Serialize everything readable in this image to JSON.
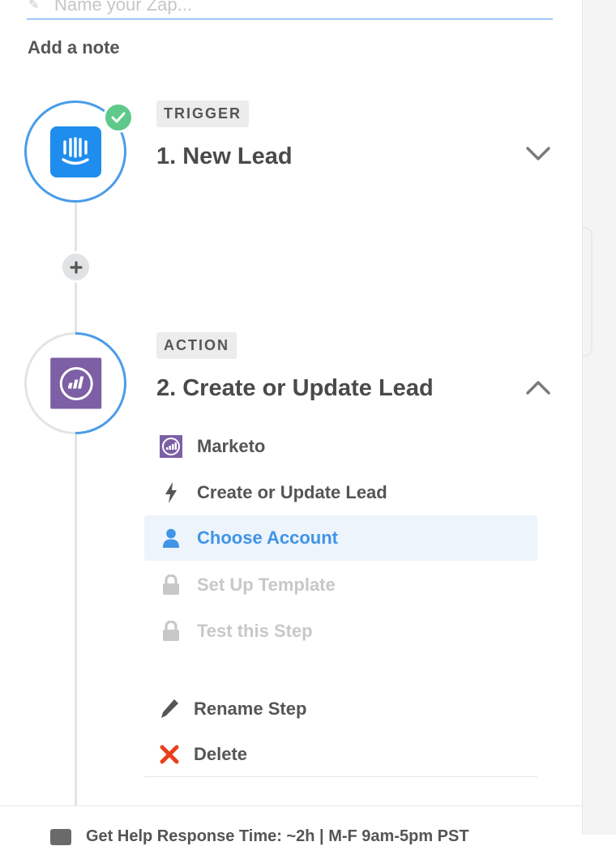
{
  "zap_name": {
    "placeholder": "Name your Zap..."
  },
  "add_note_label": "Add a note",
  "trigger": {
    "badge": "TRIGGER",
    "title": "1. New Lead",
    "app": "Intercom",
    "status": "complete"
  },
  "action": {
    "badge": "ACTION",
    "title": "2. Create or Update Lead",
    "app": "Marketo",
    "menu": [
      {
        "label": "Marketo",
        "icon": "marketo-app-icon",
        "state": "normal"
      },
      {
        "label": "Create or Update Lead",
        "icon": "lightning-bolt-icon",
        "state": "normal"
      },
      {
        "label": "Choose Account",
        "icon": "user-icon",
        "state": "active"
      },
      {
        "label": "Set Up Template",
        "icon": "lock-icon",
        "state": "locked"
      },
      {
        "label": "Test this Step",
        "icon": "lock-icon",
        "state": "locked"
      }
    ],
    "rename_label": "Rename Step",
    "delete_label": "Delete"
  },
  "footer": {
    "text": "Get Help   Response Time: ~2h | M-F 9am-5pm PST"
  },
  "colors": {
    "accent_blue": "#4a9ce9",
    "intercom_blue": "#1f8ded",
    "marketo_purple": "#7c5fa4",
    "success_green": "#5ec98a",
    "delete_red": "#e8401c"
  }
}
